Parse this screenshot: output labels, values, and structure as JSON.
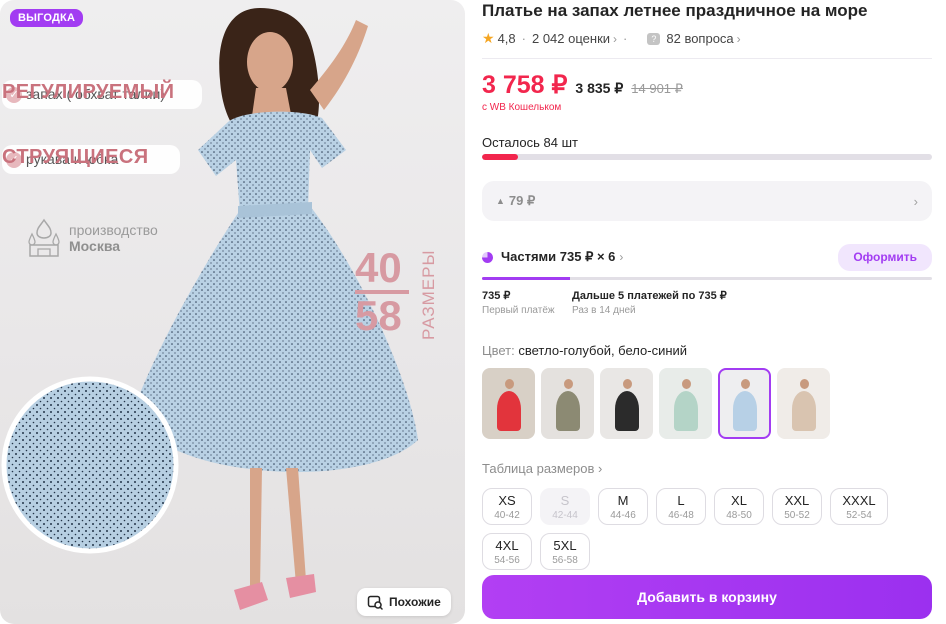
{
  "photo": {
    "badge": "ВЫГОДКА",
    "features": [
      {
        "title": "РЕГУЛИРУЕМЫЙ",
        "subtitle": "запах ( обхват талии)"
      },
      {
        "title": "СТРУЯЩИЕСЯ",
        "subtitle": "рукава и юбка"
      }
    ],
    "origin": {
      "line1": "производство",
      "line2": "Москва"
    },
    "sizes_promo": {
      "from": "40",
      "to": "58",
      "word": "РАЗМЕРЫ"
    },
    "similar_button": "Похожие"
  },
  "product": {
    "title": "Платье на запах летнее праздничное на море",
    "rating": "4,8",
    "reviews": "2 042 оценки",
    "questions": "82 вопроса"
  },
  "price": {
    "main": "3 758 ₽",
    "mid": "3 835 ₽",
    "old": "14 901 ₽",
    "wallet_note": "с WB Кошельком"
  },
  "stock": {
    "label": "Осталось 84 шт",
    "fill_fraction": 0.08
  },
  "cashback": {
    "value": "79 ₽"
  },
  "installments": {
    "label": "Частями 735 ₽ × 6",
    "checkout_button": "Оформить",
    "progress_fraction": 0.195,
    "first": {
      "amount": "735 ₽",
      "note": "Первый платёж"
    },
    "rest": {
      "amount": "Дальше 5 платежей по 735 ₽",
      "note": "Раз в 14 дней"
    }
  },
  "color": {
    "label": "Цвет:",
    "value": "светло-голубой, бело-синий",
    "swatches": [
      {
        "name": "red",
        "dress": "#e2343c",
        "bg": "#d8d0c6",
        "selected": false
      },
      {
        "name": "olive",
        "dress": "#8c8a73",
        "bg": "#e4e1de",
        "selected": false
      },
      {
        "name": "black-dot",
        "dress": "#2b2b2b",
        "bg": "#e9e7e5",
        "selected": false
      },
      {
        "name": "mint",
        "dress": "#b4d4c7",
        "bg": "#e8ece9",
        "selected": false
      },
      {
        "name": "light-blue",
        "dress": "#b7d0e6",
        "bg": "#eeeef0",
        "selected": true
      },
      {
        "name": "floral",
        "dress": "#d9c4b0",
        "bg": "#f0ece8",
        "selected": false
      }
    ]
  },
  "sizes": {
    "table_link": "Таблица размеров",
    "items": [
      {
        "size": "XS",
        "ru": "40-42",
        "available": true
      },
      {
        "size": "S",
        "ru": "42-44",
        "available": false
      },
      {
        "size": "M",
        "ru": "44-46",
        "available": true
      },
      {
        "size": "L",
        "ru": "46-48",
        "available": true
      },
      {
        "size": "XL",
        "ru": "48-50",
        "available": true
      },
      {
        "size": "XXL",
        "ru": "50-52",
        "available": true
      },
      {
        "size": "XXXL",
        "ru": "52-54",
        "available": true
      },
      {
        "size": "4XL",
        "ru": "54-56",
        "available": true
      },
      {
        "size": "5XL",
        "ru": "56-58",
        "available": true
      }
    ]
  },
  "cart_button": "Добавить в корзину",
  "colors": {
    "accent": "#a23cf2",
    "price": "#f2264d",
    "promo_pink": "#d79aa2"
  }
}
